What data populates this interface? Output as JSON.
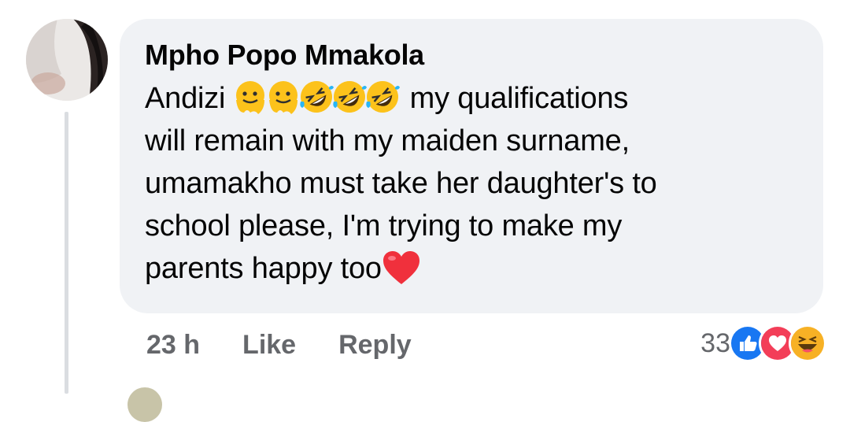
{
  "comment": {
    "author": "Mpho Popo Mmakola",
    "text_lines": [
      "Andizi",
      "my qualifications",
      "will remain with my maiden surname,",
      "umamakho must take her daughter's to",
      "school please,  I'm trying to make my",
      "parents happy too"
    ],
    "inline_emojis": [
      "melting-face",
      "melting-face",
      "rofl",
      "rofl",
      "rofl"
    ],
    "trailing_emoji": "red-heart"
  },
  "actions": {
    "time": "23 h",
    "like_label": "Like",
    "reply_label": "Reply"
  },
  "reactions": {
    "count": "33",
    "icons": [
      "like-icon",
      "love-icon",
      "haha-icon"
    ],
    "colors": {
      "like": "#1877f2",
      "love": "#f33e58",
      "haha": "#f7b125"
    }
  }
}
